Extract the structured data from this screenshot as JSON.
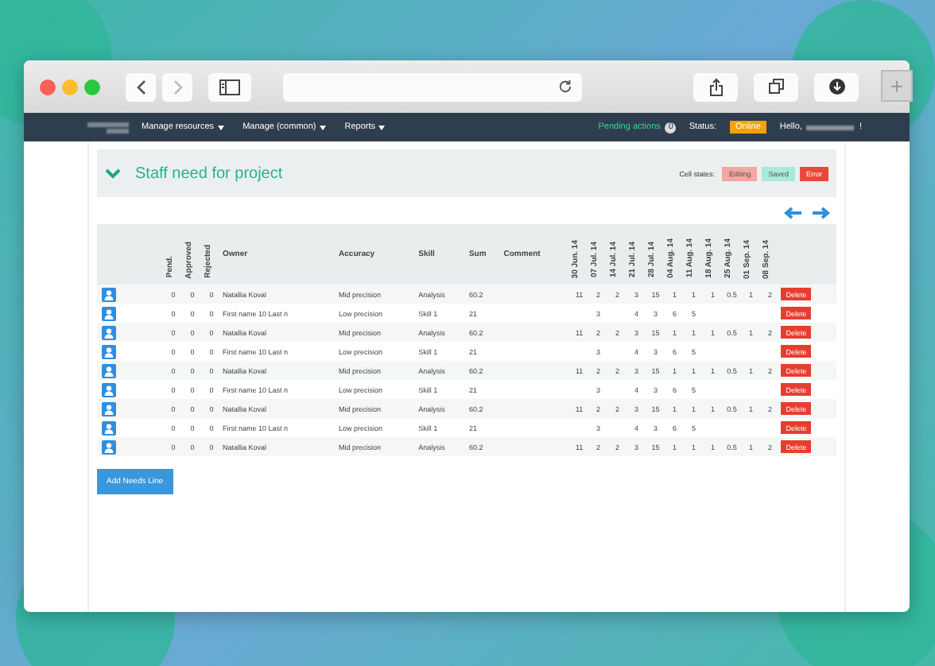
{
  "nav": {
    "menus": [
      {
        "label": "Manage resources"
      },
      {
        "label": "Manage (common)"
      },
      {
        "label": "Reports"
      }
    ],
    "pending_label": "Pending actions",
    "pending_count": "0",
    "status_label": "Status:",
    "status_value": "Online",
    "hello": "Hello,",
    "hello_end": "!"
  },
  "new_tab": "+",
  "panel": {
    "title": "Staff need for project",
    "expanded": true,
    "cell_states_label": "Cell states:",
    "cell_states": [
      {
        "label": "Editing",
        "color": "#f4a6a0"
      },
      {
        "label": "Saved",
        "color": "#a8ead8"
      },
      {
        "label": "Error",
        "color": "#e8483b"
      }
    ]
  },
  "table": {
    "columns": [
      "Pend.",
      "Approved",
      "Rejected",
      "Owner",
      "Accuracy",
      "Skill",
      "Sum",
      "Comment"
    ],
    "dates": [
      "30 Jun. 14",
      "07 Jul. 14",
      "14 Jul. 14",
      "21 Jul. 14",
      "28 Jul. 14",
      "04 Aug. 14",
      "11 Aug. 14",
      "18 Aug. 14",
      "25 Aug. 14",
      "01 Sep. 14",
      "08 Sep. 14"
    ],
    "rows": [
      {
        "pend": "0",
        "approved": "0",
        "rejected": "0",
        "owner": "Natallia Koval",
        "accuracy": "Mid precision",
        "skill": "Analysis",
        "sum": "60.2",
        "values": [
          "11",
          "2",
          "2",
          "3",
          "15",
          "1",
          "1",
          "1",
          "0.5",
          "1",
          "2"
        ],
        "action": "Delete"
      },
      {
        "pend": "0",
        "approved": "0",
        "rejected": "0",
        "owner": "First name 10 Last n",
        "accuracy": "Low precision",
        "skill": "Skill 1",
        "sum": "21",
        "cells": [
          {},
          {
            "value": "3"
          },
          {},
          {
            "value": "4"
          },
          {
            "value": "3"
          },
          {
            "value": "6"
          },
          {
            "value": "5"
          },
          {},
          {},
          {},
          {}
        ],
        "action": "Delete"
      },
      {
        "pend": "0",
        "approved": "0",
        "rejected": "0",
        "owner": "Natallia Koval",
        "accuracy": "Mid precision",
        "skill": "Analysis",
        "sum": "60.2",
        "values": [
          "11",
          "2",
          "2",
          "3",
          "15",
          "1",
          "1",
          "1",
          "0.5",
          "1",
          "2"
        ],
        "action": "Delete"
      },
      {
        "pend": "0",
        "approved": "0",
        "rejected": "0",
        "owner": "First name 10 Last n",
        "accuracy": "Low precision",
        "skill": "Skill 1",
        "sum": "21",
        "cells": [
          {},
          {
            "value": "3"
          },
          {},
          {
            "value": "4"
          },
          {
            "value": "3"
          },
          {
            "value": "6"
          },
          {
            "value": "5"
          },
          {},
          {},
          {},
          {}
        ],
        "action": "Delete"
      },
      {
        "pend": "0",
        "approved": "0",
        "rejected": "0",
        "owner": "Natallia Koval",
        "accuracy": "Mid precision",
        "skill": "Analysis",
        "sum": "60.2",
        "values": [
          "11",
          "2",
          "2",
          "3",
          "15",
          "1",
          "1",
          "1",
          "0.5",
          "1",
          "2"
        ],
        "action": "Delete"
      },
      {
        "pend": "0",
        "approved": "0",
        "rejected": "0",
        "owner": "First name 10 Last n",
        "accuracy": "Low precision",
        "skill": "Skill 1",
        "sum": "21",
        "cells": [
          {},
          {
            "value": "3"
          },
          {},
          {
            "value": "4"
          },
          {
            "value": "3"
          },
          {
            "value": "6"
          },
          {
            "value": "5"
          },
          {},
          {},
          {},
          {}
        ],
        "action": "Delete"
      },
      {
        "pend": "0",
        "approved": "0",
        "rejected": "0",
        "owner": "Natallia Koval",
        "accuracy": "Mid precision",
        "skill": "Analysis",
        "sum": "60.2",
        "values": [
          "11",
          "2",
          "2",
          "3",
          "15",
          "1",
          "1",
          "1",
          "0.5",
          "1",
          "2"
        ],
        "action": "Delete"
      },
      {
        "pend": "0",
        "approved": "0",
        "rejected": "0",
        "owner": "First name 10 Last n",
        "accuracy": "Low precision",
        "skill": "Skill 1",
        "sum": "21",
        "cells": [
          {},
          {
            "value": "3"
          },
          {},
          {
            "value": "4"
          },
          {
            "value": "3"
          },
          {
            "value": "6"
          },
          {
            "value": "5"
          },
          {},
          {},
          {},
          {}
        ],
        "action": "Delete"
      },
      {
        "pend": "0",
        "approved": "0",
        "rejected": "0",
        "owner": "Natallia Koval",
        "accuracy": "Mid precision",
        "skill": "Analysis",
        "sum": "60.2",
        "values": [
          "11",
          "2",
          "2",
          "3",
          "15",
          "1",
          "1",
          "1",
          "0.5",
          "1",
          "2"
        ],
        "action": "Delete"
      }
    ]
  },
  "add_button": "Add Needs Line"
}
